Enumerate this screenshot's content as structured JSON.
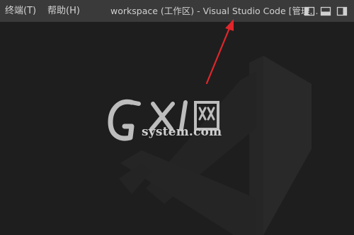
{
  "menu": {
    "terminal_label": "终端(T)",
    "help_label": "帮助(H)"
  },
  "window": {
    "title": "workspace (工作区) - Visual Studio Code [管理..."
  },
  "layout_controls": [
    {
      "icon": "toggle-primary-sidebar-icon"
    },
    {
      "icon": "toggle-panel-icon"
    },
    {
      "icon": "toggle-secondary-sidebar-icon"
    }
  ],
  "watermark": {
    "logo_letters": "GXI网",
    "site": "system.com"
  },
  "colors": {
    "titlebar_bg": "#3a3a3a",
    "editor_bg": "#1e1e1e",
    "annotation_arrow": "#e0262b"
  }
}
